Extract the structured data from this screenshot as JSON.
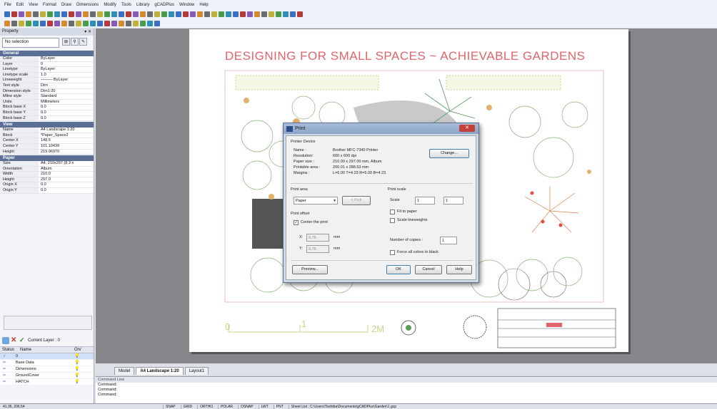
{
  "menu": [
    "File",
    "Edit",
    "View",
    "Format",
    "Draw",
    "Dimensions",
    "Modify",
    "Tools",
    "Library",
    "gCADPlus",
    "Window",
    "Help"
  ],
  "colors": {
    "accent": "#e2646c",
    "section": "#5b6e95",
    "canvas": "#85858a"
  },
  "property": {
    "title": "Property",
    "selection": "No selection",
    "sections": [
      {
        "name": "General",
        "rows": [
          [
            "Color",
            "ByLayer"
          ],
          [
            "Layer",
            "0"
          ],
          [
            "Linetype",
            "ByLayer"
          ],
          [
            "Linetype scale",
            "1.0"
          ],
          [
            "Lineweight",
            "——— ByLayer"
          ],
          [
            "Text style",
            "Dim"
          ],
          [
            "Dimension style",
            "Dim1:20"
          ],
          [
            "Mline style",
            "Standard"
          ],
          [
            "Units",
            "Millimeters"
          ],
          [
            "Block base X",
            "0.0"
          ],
          [
            "Block base Y",
            "0.0"
          ],
          [
            "Block base Z",
            "0.0"
          ]
        ]
      },
      {
        "name": "View",
        "rows": [
          [
            "Name",
            "A4 Landscape 1:20"
          ],
          [
            "Block",
            "*Paper_Space2"
          ],
          [
            "Center X",
            "148.5"
          ],
          [
            "Center Y",
            "101.10439"
          ],
          [
            "Height",
            "219.96970"
          ]
        ]
      },
      {
        "name": "Paper",
        "rows": [
          [
            "Size",
            "A4, 210x297 (8.3 x"
          ],
          [
            "Orientation",
            "Album"
          ],
          [
            "Width",
            "210.0"
          ],
          [
            "Height",
            "297.0"
          ],
          [
            "Origin X",
            "0.0"
          ],
          [
            "Origin Y",
            "0.0"
          ]
        ]
      }
    ]
  },
  "layers": {
    "current": "Current Layer : 0",
    "headers": [
      "Status",
      "Name",
      "On/"
    ],
    "rows": [
      [
        "✓",
        "0"
      ],
      [
        "⇐",
        "Base Data"
      ],
      [
        "⇐",
        "Dimensions"
      ],
      [
        "⇐",
        "GroundCover"
      ],
      [
        "⇐",
        "HATCH"
      ]
    ]
  },
  "drawing": {
    "title": "DESIGNING FOR SMALL SPACES ~ ACHIEVABLE GARDENS",
    "scale_labels": [
      "0",
      "1",
      "2M"
    ]
  },
  "tabs": [
    "Model",
    "A4 Landscape 1:20",
    "Layout1"
  ],
  "command": {
    "title": "Command Line",
    "lines": [
      "Command:",
      "Command:",
      "Command:"
    ]
  },
  "status": {
    "coords": "41.36, 206.54",
    "items": [
      "SNAP",
      "GRID",
      "ORTHO",
      "POLAR",
      "OSNAP",
      "LWT",
      "PNT",
      "Sheet List : C:\\Users\\Toshiba\\Documents\\gCADPlus\\Garden\\1.gcp"
    ]
  },
  "dialog": {
    "title": "Print",
    "printer_device": "Printer Device",
    "name_label": "Name :",
    "name_value": "Brother MFC-7340 Printer",
    "resolution_label": "Resolution:",
    "resolution_value": "600 x 600 dpi",
    "papersize_label": "Paper size :",
    "papersize_value": "210.00 x 297.00 mm,  Album",
    "printable_label": "Printable area :",
    "printable_value": "200.01 x 288.53 mm",
    "margins_label": "Margins :",
    "margins_value": "L=6.00  T=4.23  R=5.00  B=4.23",
    "change_button": "Change...",
    "print_area": "Print area",
    "area_value": "Paper",
    "pick_button": "< Pick",
    "print_scale": "Print scale",
    "scale_label": "Scale",
    "scale_value_1": "1",
    "scale_value_2": "1",
    "fit_to_paper": "Fit to paper",
    "scale_lineweights": "Scale lineweights",
    "print_offset": "Print offset",
    "center_print": "Center the print",
    "x_label": "X:",
    "x_value": "0.76",
    "x_unit": "mm",
    "y_label": "Y:",
    "y_value": "0.76",
    "y_unit": "mm",
    "copies_label": "Number of copies :",
    "copies_value": "1",
    "force_black": "Force all colors to black",
    "preview_button": "Preview...",
    "ok_button": "OK",
    "cancel_button": "Cancel",
    "help_button": "Help"
  }
}
